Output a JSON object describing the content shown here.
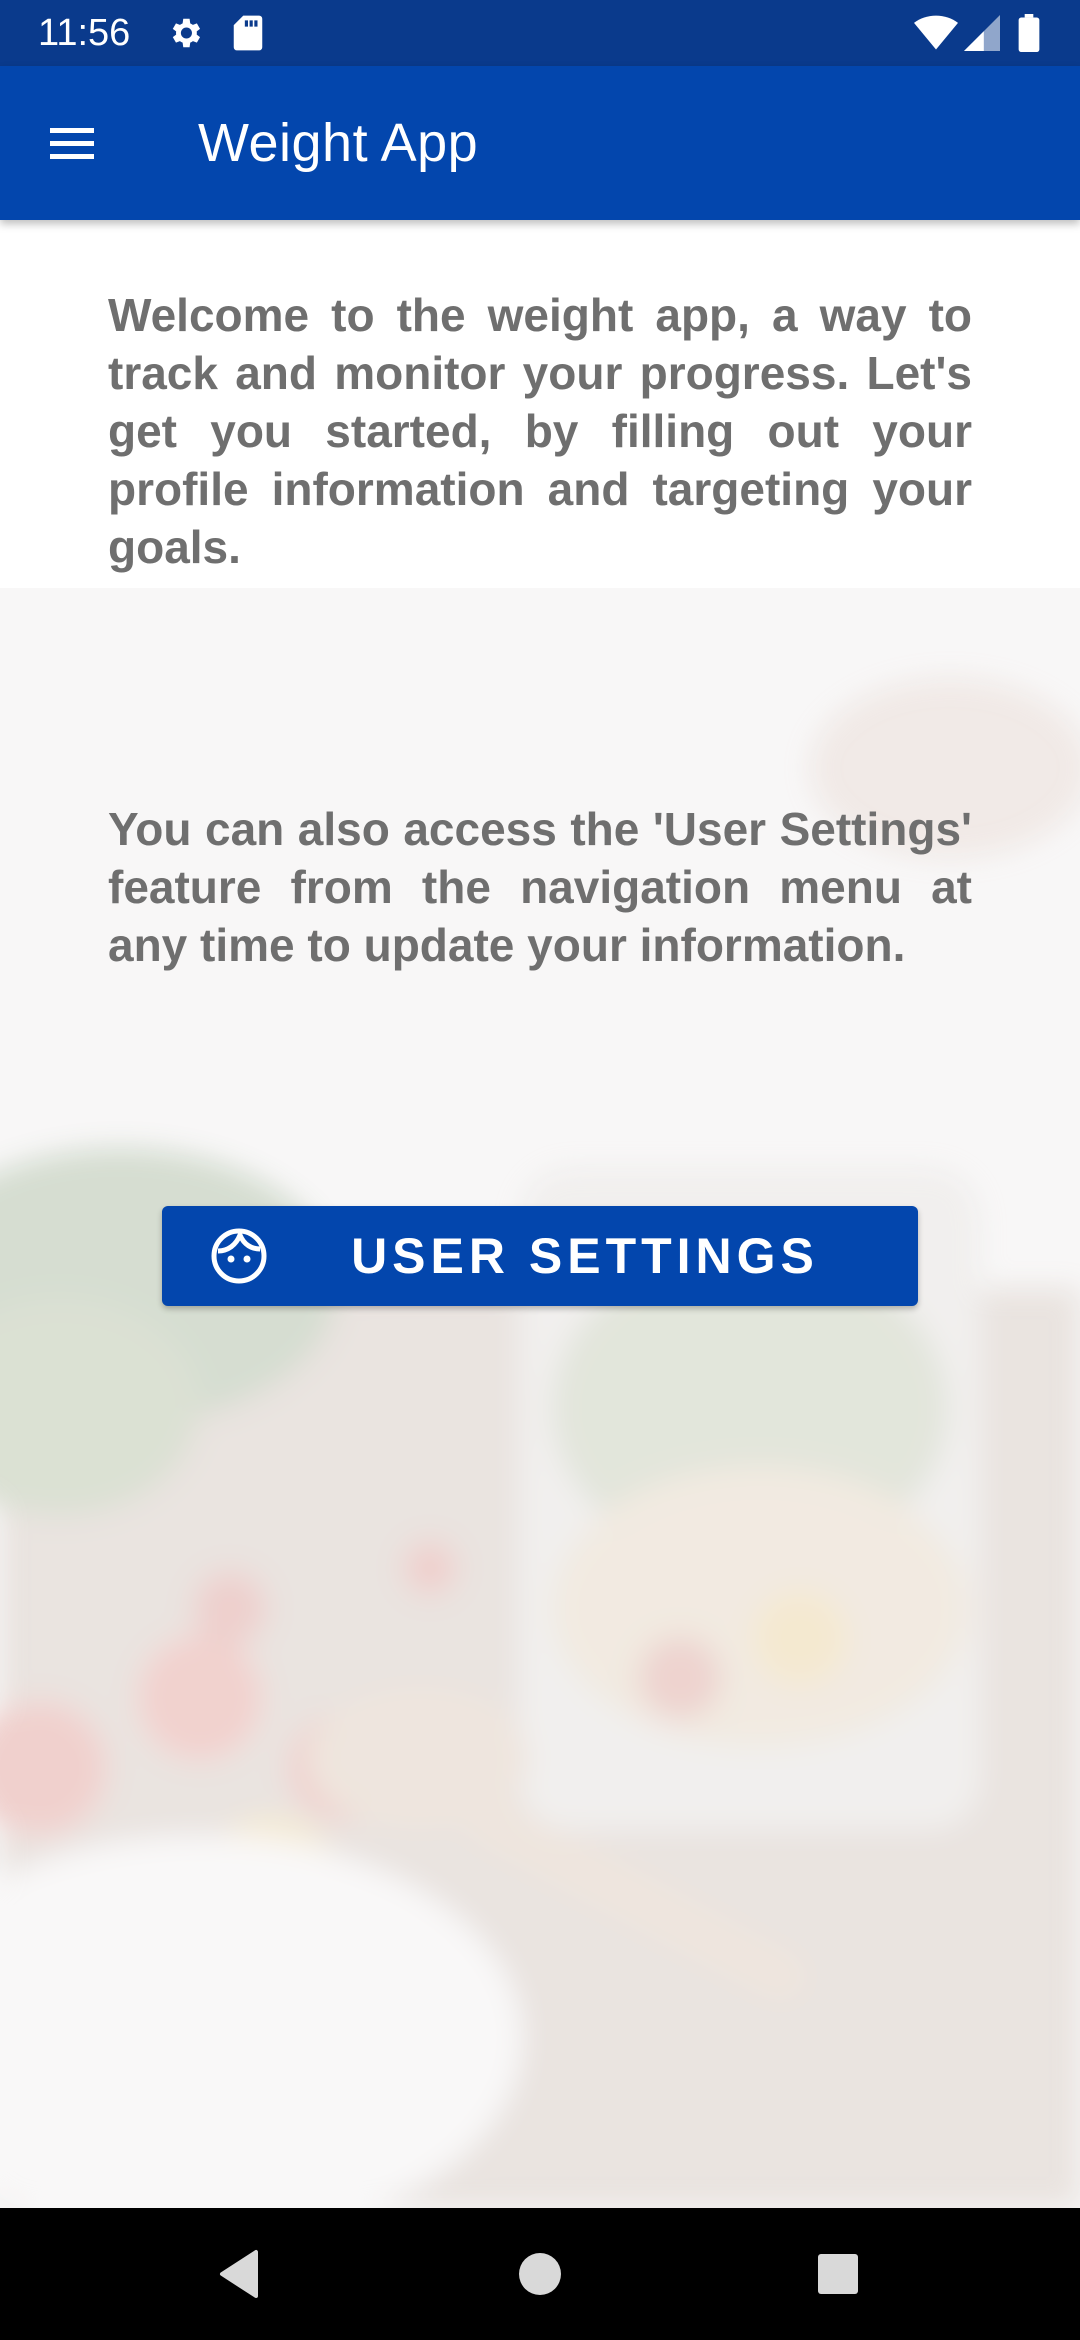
{
  "status_bar": {
    "time": "11:56",
    "icons": [
      "gear-icon",
      "sd-card-icon",
      "wifi-icon",
      "signal-icon",
      "battery-icon"
    ]
  },
  "app_bar": {
    "title": "Weight App",
    "menu_icon": "hamburger-menu-icon"
  },
  "main": {
    "welcome_text": "Welcome to the weight app, a way to track and monitor your progress. Let's get you started, by filling out your profile information and targeting your goals.",
    "settings_hint_text": "You can also access the 'User Settings' feature from the navigation menu at any time to update your information.",
    "user_settings_button": {
      "label": "USER SETTINGS",
      "icon": "face-icon"
    }
  },
  "nav_bar": {
    "icons": [
      "back-icon",
      "home-icon",
      "recents-icon"
    ]
  },
  "colors": {
    "status_bar": "#0a3a8c",
    "primary": "#0346ad",
    "body_text": "#6f6f6f",
    "nav_bar": "#000000"
  }
}
